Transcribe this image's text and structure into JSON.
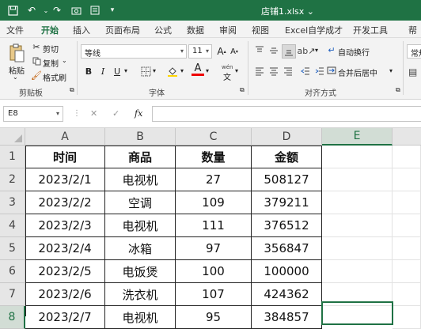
{
  "window": {
    "title": "店铺1.xlsx ⌄"
  },
  "tabs": [
    "文件",
    "开始",
    "插入",
    "页面布局",
    "公式",
    "数据",
    "审阅",
    "视图",
    "Excel自学成才",
    "开发工具",
    "帮"
  ],
  "ribbon": {
    "clipboard": {
      "paste": "粘贴",
      "cut": "剪切",
      "copy": "复制",
      "format_painter": "格式刷",
      "label": "剪贴板"
    },
    "font": {
      "name": "等线",
      "size": "11",
      "label": "字体",
      "bold": "B",
      "italic": "I",
      "underline": "U",
      "font_color_glyph": "A",
      "wen": "wén"
    },
    "alignment": {
      "wrap": "自动换行",
      "merge": "合并后居中",
      "label": "对齐方式"
    },
    "number": {
      "format": "常规"
    }
  },
  "formula_bar": {
    "name_box": "E8",
    "cancel": "✕",
    "enter": "✓",
    "fx": "fx",
    "value": ""
  },
  "sheet": {
    "columns": [
      "A",
      "B",
      "C",
      "D",
      "E"
    ],
    "rows": [
      "1",
      "2",
      "3",
      "4",
      "5",
      "6",
      "7",
      "8"
    ],
    "headers": [
      "时间",
      "商品",
      "数量",
      "金额"
    ],
    "data": [
      [
        "2023/2/1",
        "电视机",
        "27",
        "508127"
      ],
      [
        "2023/2/2",
        "空调",
        "109",
        "379211"
      ],
      [
        "2023/2/3",
        "电视机",
        "111",
        "376512"
      ],
      [
        "2023/2/4",
        "冰箱",
        "97",
        "356847"
      ],
      [
        "2023/2/5",
        "电饭煲",
        "100",
        "100000"
      ],
      [
        "2023/2/6",
        "洗衣机",
        "107",
        "424362"
      ],
      [
        "2023/2/7",
        "电视机",
        "95",
        "384857"
      ]
    ],
    "selected_cell": "E8"
  },
  "colors": {
    "accent": "#1f7244",
    "header_bg": "#e6e6e6",
    "ribbon_bg": "#f3f3f3"
  }
}
